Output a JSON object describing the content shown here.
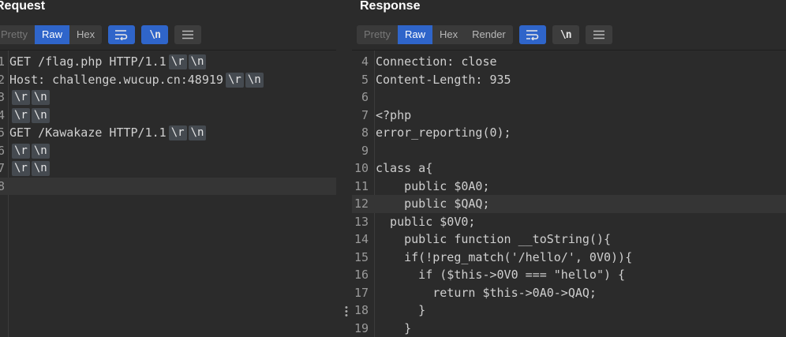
{
  "request": {
    "title": "Request",
    "view_tabs": [
      {
        "label": "Pretty",
        "state": "disabled"
      },
      {
        "label": "Raw",
        "state": "active"
      },
      {
        "label": "Hex",
        "state": "normal"
      }
    ],
    "tool_buttons": [
      {
        "icon": "wrap-lines-icon",
        "active": true
      },
      {
        "icon": "show-newlines-icon",
        "label": "\\n",
        "active": true
      },
      {
        "icon": "menu-icon",
        "active": false
      }
    ],
    "lines": [
      {
        "num": "1",
        "text": "GET /flag.php HTTP/1.1",
        "crlf": [
          "\\r",
          "\\n"
        ]
      },
      {
        "num": "2",
        "text": "Host: challenge.wucup.cn:48919",
        "crlf": [
          "\\r",
          "\\n"
        ]
      },
      {
        "num": "3",
        "text": "",
        "crlf": [
          "\\r",
          "\\n"
        ]
      },
      {
        "num": "4",
        "text": "",
        "crlf": [
          "\\r",
          "\\n"
        ]
      },
      {
        "num": "5",
        "text": "GET /Kawakaze HTTP/1.1",
        "crlf": [
          "\\r",
          "\\n"
        ]
      },
      {
        "num": "6",
        "text": "",
        "crlf": [
          "\\r",
          "\\n"
        ]
      },
      {
        "num": "7",
        "text": "",
        "crlf": [
          "\\r",
          "\\n"
        ]
      },
      {
        "num": "8",
        "text": "",
        "crlf": [],
        "current": true
      }
    ]
  },
  "response": {
    "title": "Response",
    "view_tabs": [
      {
        "label": "Pretty",
        "state": "disabled"
      },
      {
        "label": "Raw",
        "state": "active"
      },
      {
        "label": "Hex",
        "state": "normal"
      },
      {
        "label": "Render",
        "state": "normal"
      }
    ],
    "tool_buttons": [
      {
        "icon": "wrap-lines-icon",
        "active": true
      },
      {
        "icon": "show-newlines-icon",
        "label": "\\n",
        "active": false
      },
      {
        "icon": "menu-icon",
        "active": false
      }
    ],
    "lines": [
      {
        "num": "4",
        "text": "Connection: close"
      },
      {
        "num": "5",
        "text": "Content-Length: 935"
      },
      {
        "num": "6",
        "text": ""
      },
      {
        "num": "7",
        "text": "<?php"
      },
      {
        "num": "8",
        "text": "error_reporting(0);"
      },
      {
        "num": "9",
        "text": ""
      },
      {
        "num": "10",
        "text": "class a{"
      },
      {
        "num": "11",
        "text": "    public $0A0;"
      },
      {
        "num": "12",
        "text": "    public $QAQ;",
        "current": true
      },
      {
        "num": "13",
        "text": "  public $0V0;"
      },
      {
        "num": "14",
        "text": "    public function __toString(){"
      },
      {
        "num": "15",
        "text": "    if(!preg_match('/hello/', 0V0)){"
      },
      {
        "num": "16",
        "text": "      if ($this->0V0 === \"hello\") {"
      },
      {
        "num": "17",
        "text": "        return $this->0A0->QAQ;"
      },
      {
        "num": "18",
        "text": "      }"
      },
      {
        "num": "19",
        "text": "    }"
      }
    ]
  },
  "colors": {
    "accent": "#2f65ca",
    "background": "#2b2b2b",
    "current_line": "#353535",
    "crlf_badge": "#454a50"
  }
}
